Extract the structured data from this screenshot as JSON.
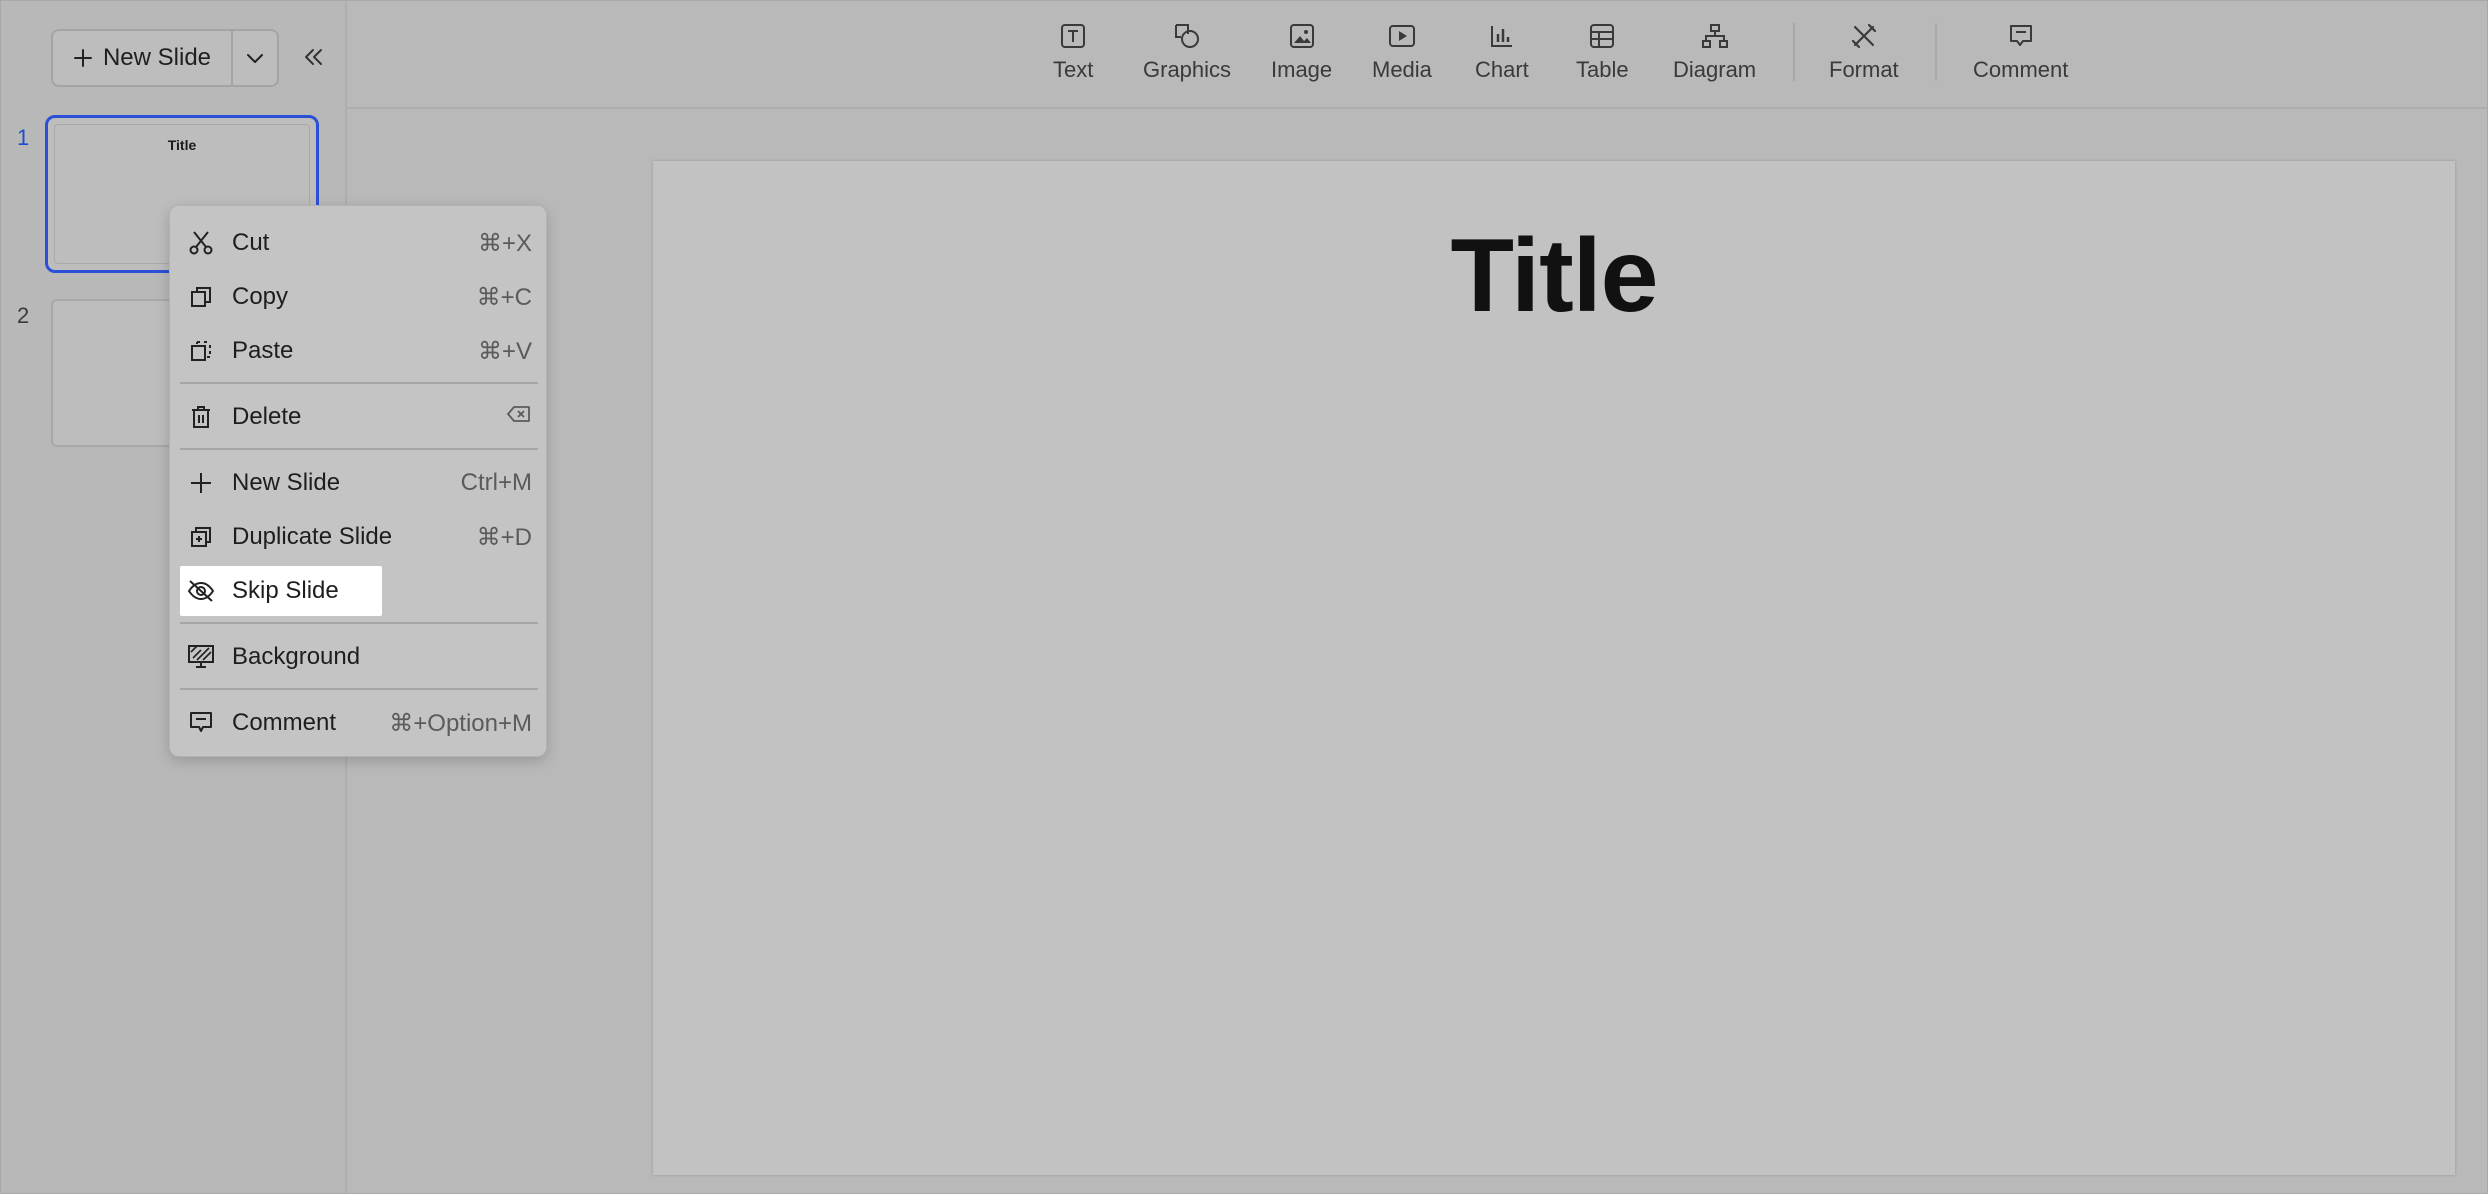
{
  "sidebar": {
    "new_slide_label": "New Slide",
    "slides": [
      {
        "number": "1",
        "title": "Title",
        "active": true
      },
      {
        "number": "2",
        "title": "",
        "active": false
      }
    ]
  },
  "toolbar": {
    "items": [
      {
        "label": "Text",
        "icon": "text-box-icon"
      },
      {
        "label": "Graphics",
        "icon": "shapes-icon"
      },
      {
        "label": "Image",
        "icon": "image-icon"
      },
      {
        "label": "Media",
        "icon": "media-play-icon"
      },
      {
        "label": "Chart",
        "icon": "bar-chart-icon"
      },
      {
        "label": "Table",
        "icon": "table-icon"
      },
      {
        "label": "Diagram",
        "icon": "org-chart-icon"
      },
      {
        "label": "Format",
        "icon": "format-tools-icon"
      },
      {
        "label": "Comment",
        "icon": "comment-icon"
      }
    ]
  },
  "canvas": {
    "title": "Title"
  },
  "context_menu": {
    "items": [
      {
        "label": "Cut",
        "shortcut": "⌘+X",
        "icon": "scissors-icon"
      },
      {
        "label": "Copy",
        "shortcut": "⌘+C",
        "icon": "copy-icon"
      },
      {
        "label": "Paste",
        "shortcut": "⌘+V",
        "icon": "paste-icon"
      },
      {
        "label": "Delete",
        "shortcut": "",
        "icon": "trash-icon",
        "shortcut_icon": "backspace-icon"
      },
      {
        "label": "New Slide",
        "shortcut": "Ctrl+M",
        "icon": "plus-icon"
      },
      {
        "label": "Duplicate Slide",
        "shortcut": "⌘+D",
        "icon": "duplicate-icon"
      },
      {
        "label": "Skip Slide",
        "shortcut": "",
        "icon": "eye-off-icon",
        "highlighted": true
      },
      {
        "label": "Background",
        "shortcut": "",
        "icon": "background-icon"
      },
      {
        "label": "Comment",
        "shortcut": "⌘+Option+M",
        "icon": "comment-icon"
      }
    ]
  },
  "colors": {
    "accent": "#2b50d8",
    "background": "#b9b9b9",
    "canvas": "#c2c2c2",
    "menu_highlight": "#ffffff"
  }
}
